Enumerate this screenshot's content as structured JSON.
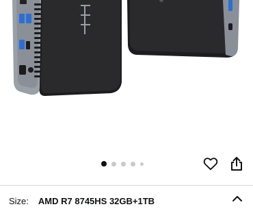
{
  "product_gallery": {
    "image_alt": "Mini PC front and back view",
    "image_count": 5,
    "active_index": 0
  },
  "actions": {
    "wishlist_icon": "heart-outline-icon",
    "share_icon": "share-icon"
  },
  "variant": {
    "label": "Size:",
    "value": "AMD R7 8745HS 32GB+1TB",
    "expand_icon": "chevron-up-icon"
  },
  "colors": {
    "device_body": "#1d1d1f",
    "device_frame": "#8a8f98",
    "port_blue": "#2b6fd6",
    "text": "#0f1111",
    "divider": "#d5d9d9"
  }
}
